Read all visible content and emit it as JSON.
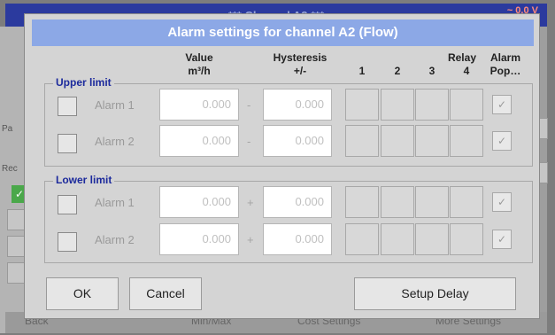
{
  "background": {
    "title": "*** Channel A2 ***",
    "voltage": "~ 0.0 V",
    "left_labels": [
      "Pa",
      "Rec"
    ],
    "check_glyph": "✓",
    "bottom_items": [
      "Back",
      "Min/Max",
      "Cost Settings",
      "More Settings"
    ]
  },
  "dialog": {
    "title": "Alarm settings for channel A2 (Flow)",
    "columns": {
      "value": "Value",
      "value_unit": "m³/h",
      "hysteresis": "Hysteresis",
      "hysteresis_unit": "+/-",
      "relay": "Relay",
      "relay_numbers": [
        "1",
        "2",
        "3",
        "4"
      ],
      "alarm": "Alarm",
      "alarm_popup": "Pop…"
    },
    "upper": {
      "label": "Upper limit",
      "alarms": [
        {
          "label": "Alarm 1",
          "value": "0.000",
          "sign": "-",
          "hysteresis": "0.000",
          "popup_check": "✓"
        },
        {
          "label": "Alarm 2",
          "value": "0.000",
          "sign": "-",
          "hysteresis": "0.000",
          "popup_check": "✓"
        }
      ]
    },
    "lower": {
      "label": "Lower limit",
      "alarms": [
        {
          "label": "Alarm 1",
          "value": "0.000",
          "sign": "+",
          "hysteresis": "0.000",
          "popup_check": "✓"
        },
        {
          "label": "Alarm 2",
          "value": "0.000",
          "sign": "+",
          "hysteresis": "0.000",
          "popup_check": "✓"
        }
      ]
    },
    "buttons": {
      "ok": "OK",
      "cancel": "Cancel",
      "setup_delay": "Setup Delay"
    }
  },
  "colors": {
    "title_bar": "#8ca8e6",
    "group_label": "#1c2a9c",
    "dialog_bg": "#d4d4d4"
  }
}
